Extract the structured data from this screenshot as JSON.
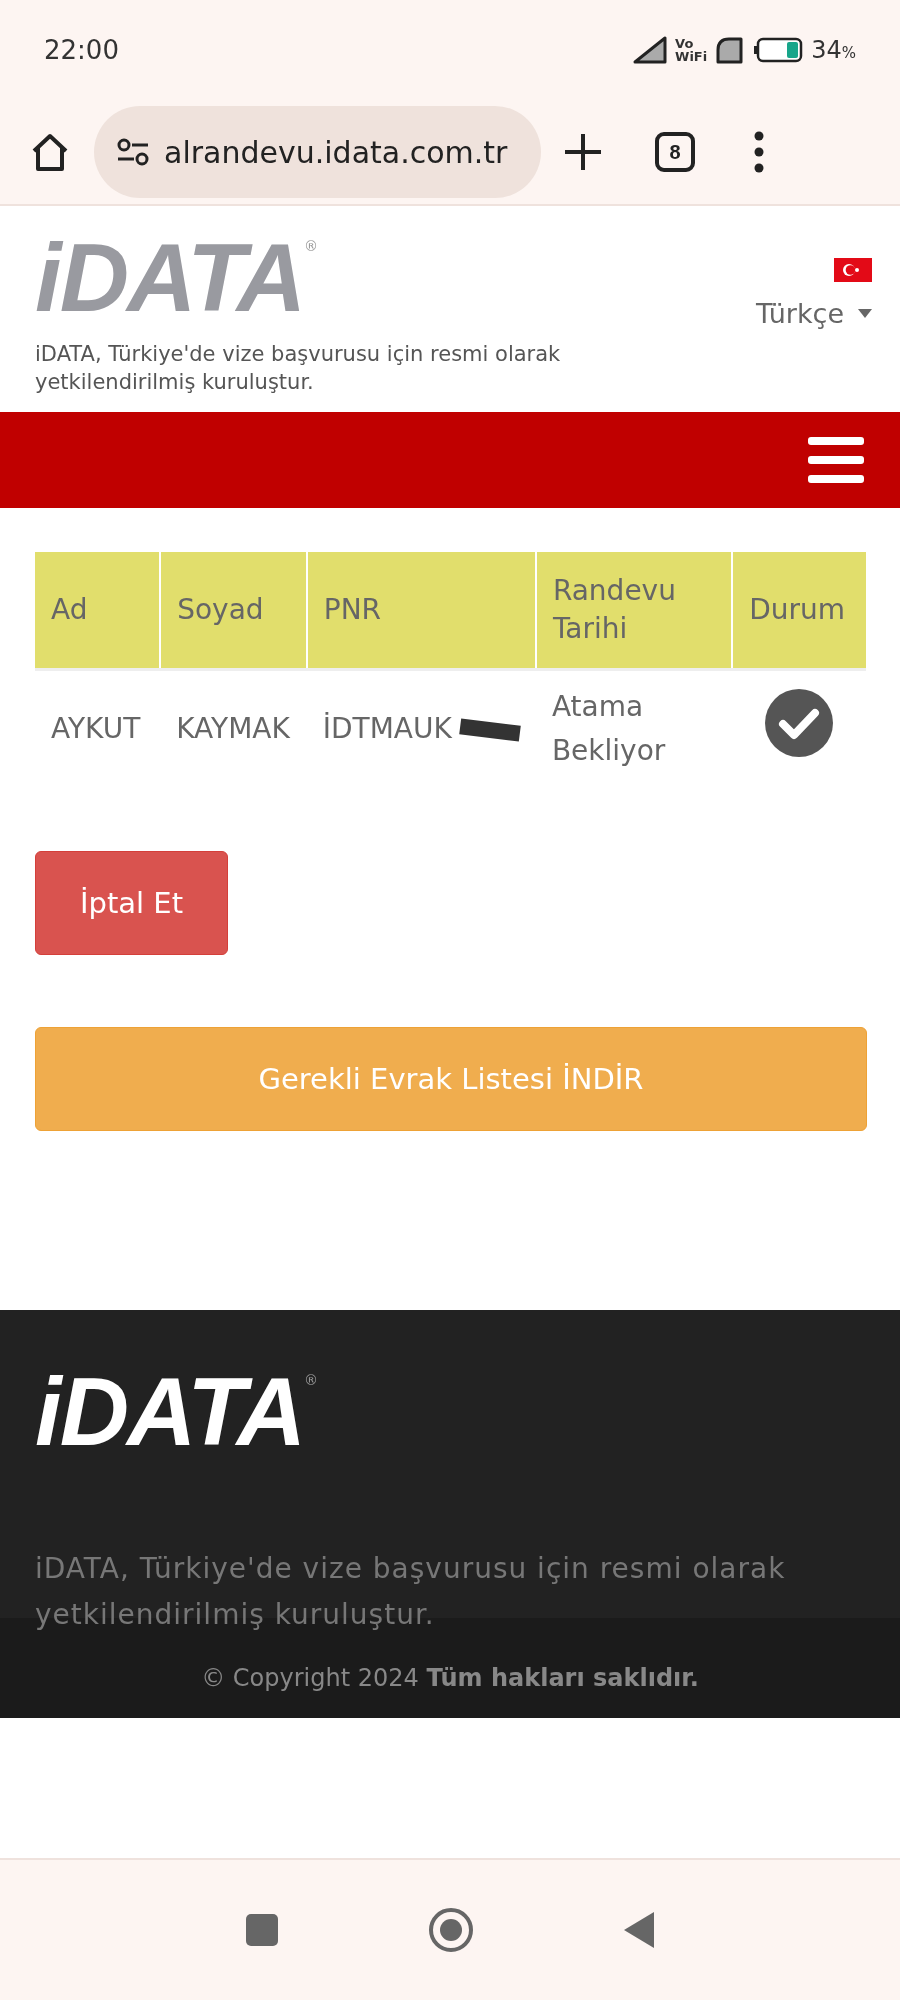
{
  "status_bar": {
    "time": "22:00",
    "vowifi_top": "Vo",
    "vowifi_bottom": "WiFi",
    "battery_level": "34",
    "battery_unit": "%"
  },
  "browser": {
    "url": "alrandevu.idata.com.tr",
    "tab_count": "8"
  },
  "header": {
    "logo": "iDATA",
    "logo_mark": "®",
    "language": "Türkçe",
    "tagline": "iDATA, Türkiye'de vize başvurusu için resmi olarak yetkilendirilmiş kuruluştur."
  },
  "table": {
    "columns": [
      "Ad",
      "Soyad",
      "PNR",
      "Randevu Tarihi",
      "Durum"
    ],
    "rows": [
      {
        "ad": "AYKUT",
        "soyad": "KAYMAK",
        "pnr": "İDTMAUK",
        "randevu_tarihi": "Atama Bekliyor"
      }
    ]
  },
  "buttons": [
    {
      "label": "İptal Et",
      "kind": "danger"
    },
    {
      "label": "Gerekli Evrak Listesi İNDİR",
      "kind": "warning"
    }
  ],
  "footer": {
    "logo": "iDATA",
    "logo_mark": "®",
    "tagline": "iDATA, Türkiye'de vize başvurusu için resmi olarak yetkilendirilmiş kuruluştur.",
    "copyright": "© Copyright 2024 **Tüm hakları saklıdır.**"
  }
}
